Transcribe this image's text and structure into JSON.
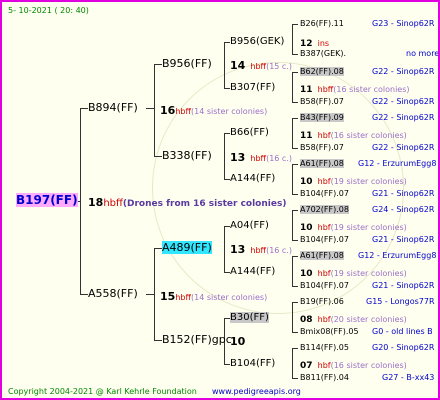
{
  "header": {
    "date": "5- 10-2021 ( 20: 40)"
  },
  "footer": {
    "copyright": "Copyright 2004-2021 @ Karl Kehrle Foundation",
    "website": "www.pedigreeapis.org"
  },
  "colors": {
    "frame": "#e000e0",
    "number_red": "#cc0000",
    "links_blue": "#0000cc",
    "footer_green": "#008800",
    "highlight_cyan": "#33e6ff",
    "highlight_pink": "#ffaaff",
    "highlight_gray": "#c8c8c8"
  },
  "root": {
    "id": "B197(FF)",
    "num": "18",
    "abbr": "hbff",
    "note": "(Drones from 16 sister colonies)"
  },
  "gen1": {
    "sire": {
      "id": "B894(FF)",
      "num": "16",
      "abbr": "hbff",
      "note": "(14 sister colonies)"
    },
    "dam": {
      "id": "A558(FF)",
      "num": "15",
      "abbr": "hbff",
      "note": "(14 sister colonies)"
    }
  },
  "gen2": {
    "a": {
      "id": "B956(FF)",
      "num": "14",
      "abbr": "hbff",
      "note": "(15 c.)"
    },
    "b": {
      "id": "B338(FF)",
      "num": "13",
      "abbr": "hbff",
      "note": "(16 c.)"
    },
    "c": {
      "id": "A489(FF)",
      "num": "13",
      "abbr": "hbff",
      "note": "(16 c.)"
    },
    "d": {
      "id": "B152(FF)gpc",
      "num": "10",
      "abbr": "",
      "note": ""
    }
  },
  "gen3": {
    "a1": {
      "id": "B956(GEK)",
      "num": "12",
      "abbr": "ins",
      "note": ""
    },
    "a2": {
      "id": "B307(FF)",
      "num": "11",
      "abbr": "hbff",
      "note": "(16 sister colonies)"
    },
    "b1": {
      "id": "B66(FF)",
      "num": "11",
      "abbr": "hbf",
      "note": "(16 sister colonies)"
    },
    "b2": {
      "id": "A144(FF)",
      "num": "10",
      "abbr": "hbf",
      "note": "(19 sister colonies)"
    },
    "c1": {
      "id": "A04(FF)",
      "num": "10",
      "abbr": "hbf",
      "note": "(19 sister colonies)"
    },
    "c2": {
      "id": "A144(FF)",
      "num": "10",
      "abbr": "hbf",
      "note": "(19 sister colonies)"
    },
    "d1": {
      "id": "B30(FF)",
      "num": "08",
      "abbr": "hbf",
      "note": "(20 sister colonies)"
    },
    "d2": {
      "id": "B104(FF)",
      "num": "07",
      "abbr": "hbf",
      "note": "(16 sister colonies)"
    }
  },
  "gen4": [
    {
      "id": "B26(FF).11",
      "link": "G23 - Sinop62R"
    },
    {
      "id": "B387(GEK).",
      "link": "no more"
    },
    {
      "id": "B62(FF).08",
      "link": "G22 - Sinop62R"
    },
    {
      "id": "B58(FF).07",
      "link": "G22 - Sinop62R"
    },
    {
      "id": "B43(FF).09",
      "link": "G22 - Sinop62R"
    },
    {
      "id": "B58(FF).07",
      "link": "G22 - Sinop62R"
    },
    {
      "id": "A61(FF).08",
      "link": "G12 - ErzurumEgg8"
    },
    {
      "id": "B104(FF).07",
      "link": "G21 - Sinop62R"
    },
    {
      "id": "A702(FF).08",
      "link": "G24 - Sinop62R"
    },
    {
      "id": "B104(FF).07",
      "link": "G21 - Sinop62R"
    },
    {
      "id": "A61(FF).08",
      "link": "G12 - ErzurumEgg8"
    },
    {
      "id": "B104(FF).07",
      "link": "G21 - Sinop62R"
    },
    {
      "id": "B19(FF).06",
      "link": "G15 - Longos77R"
    },
    {
      "id": "Bmix08(FF).05",
      "link": "G0 - old lines B"
    },
    {
      "id": "B114(FF).05",
      "link": "G20 - Sinop62R"
    },
    {
      "id": "B811(FF).04",
      "link": "G27 - B-xx43"
    }
  ]
}
